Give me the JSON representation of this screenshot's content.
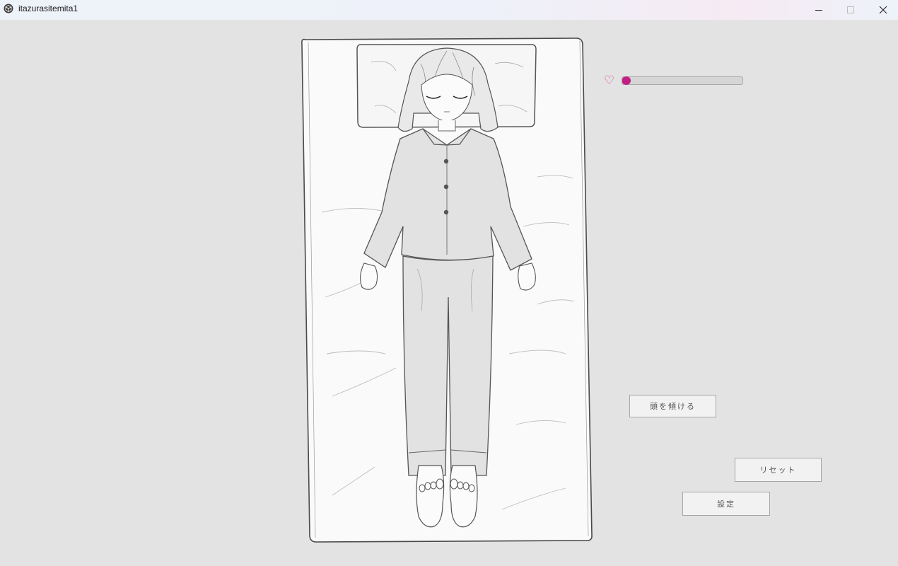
{
  "window": {
    "title": "itazurasitemita1",
    "icon": "unity-cube-icon",
    "controls": [
      "minimize-icon",
      "maximize-icon",
      "close-icon"
    ]
  },
  "hud": {
    "heart_icon": "♡",
    "affection_progress": 0.03,
    "heart_color": "#d84b9b",
    "meter_fill_color": "#c72c8e"
  },
  "buttons": {
    "tilt_head": "頭を傾ける",
    "reset": "リセット",
    "settings": "設定"
  },
  "scene": {
    "description_icon": "sleeping-girl-on-bed-illustration"
  }
}
